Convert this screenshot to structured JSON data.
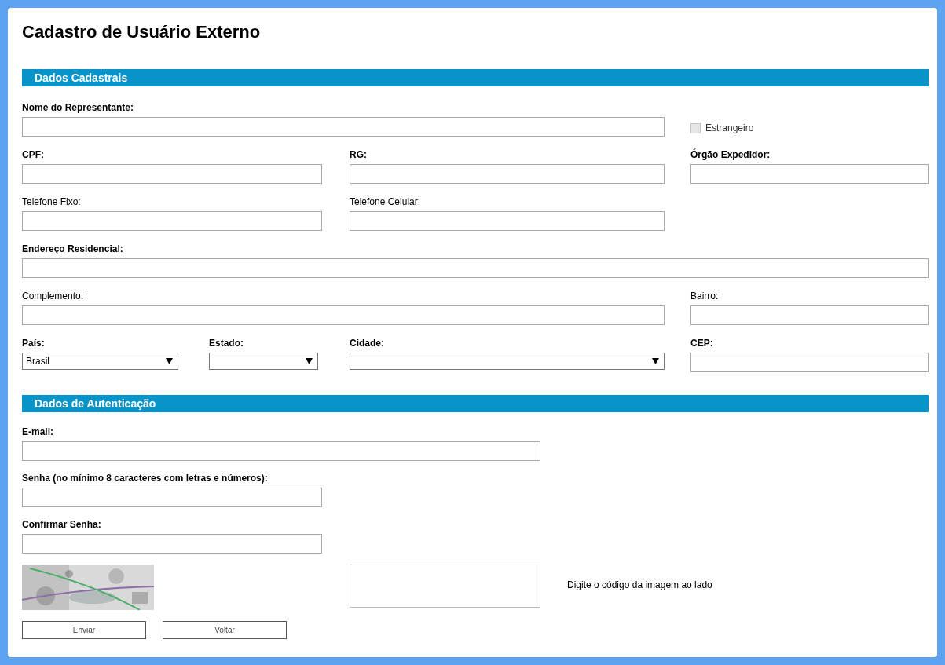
{
  "title": "Cadastro de Usuário Externo",
  "sections": [
    {
      "heading": "Dados Cadastrais",
      "rows": [
        [
          {
            "kind": "text",
            "label": "Nome do Representante:",
            "bold": true
          },
          {
            "kind": "checkbox",
            "label": "Estrangeiro",
            "checked": false,
            "disabled": true
          }
        ],
        [
          {
            "kind": "text",
            "label": "CPF:",
            "bold": true
          },
          "",
          {
            "kind": "text",
            "label": "RG:",
            "bold": true
          },
          {
            "kind": "text",
            "label": "Órgão Expedidor:",
            "bold": true
          }
        ],
        [
          {
            "kind": "text",
            "label": "Telefone Fixo:",
            "bold": false
          },
          "",
          {
            "kind": "text",
            "label": "Telefone Celular:",
            "bold": false
          }
        ],
        [
          {
            "kind": "text",
            "label": "Endereço Residencial:",
            "bold": true
          }
        ],
        [
          {
            "kind": "text",
            "label": "Complemento:",
            "bold": false
          },
          {
            "kind": "text",
            "label": "Bairro:",
            "bold": false
          }
        ],
        [
          {
            "kind": "select",
            "label": "País:",
            "bold": true,
            "value": "Brasil"
          },
          {
            "kind": "select",
            "label": "Estado:",
            "bold": true
          },
          {
            "kind": "select",
            "label": "Cidade:",
            "bold": true
          },
          {
            "kind": "text",
            "label": "CEP:",
            "bold": true
          }
        ]
      ]
    },
    {
      "heading": "Dados de Autenticação",
      "rows": [
        [
          {
            "kind": "text",
            "label": "E-mail:",
            "bold": true
          }
        ],
        [
          {
            "kind": "text",
            "label": "Senha (no mínimo 8 caracteres com letras e números):",
            "bold": true
          }
        ],
        [
          {
            "kind": "text",
            "label": "Confirmar Senha:",
            "bold": true
          }
        ]
      ]
    }
  ],
  "captcha": {
    "hint": "Digite o código da imagem ao lado"
  },
  "buttons": [
    "Enviar",
    "Voltar"
  ]
}
